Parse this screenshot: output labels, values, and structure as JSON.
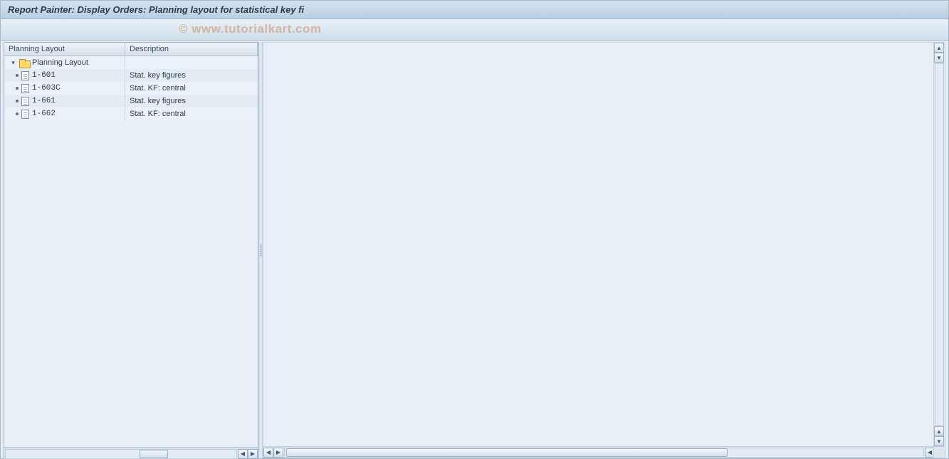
{
  "title": "Report Painter: Display Orders: Planning layout for statistical key fi",
  "watermark": "© www.tutorialkart.com",
  "tree": {
    "header_layout": "Planning Layout",
    "header_desc": "Description",
    "root_label": "Planning Layout",
    "items": [
      {
        "code": "1-601",
        "desc": "Stat. key figures"
      },
      {
        "code": "1-603C",
        "desc": "Stat. KF: central"
      },
      {
        "code": "1-661",
        "desc": "Stat. key figures"
      },
      {
        "code": "1-662",
        "desc": "Stat. KF: central"
      }
    ]
  }
}
